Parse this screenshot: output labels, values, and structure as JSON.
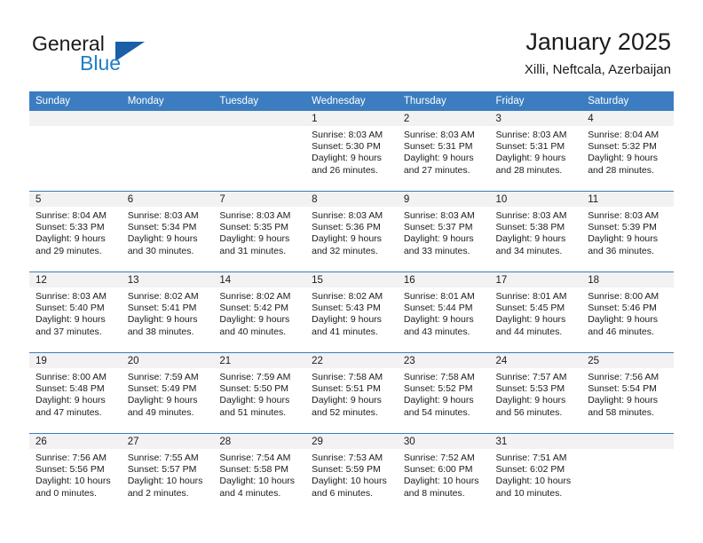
{
  "brand": {
    "word1": "General",
    "word2": "Blue",
    "logo_icon": "triangle-logo-icon",
    "colors": {
      "accent": "#1f7fc4",
      "triangle": "#1a5fa8",
      "text": "#1b1b1b"
    }
  },
  "header": {
    "title": "January 2025",
    "subtitle": "Xilli, Neftcala, Azerbaijan"
  },
  "calendar": {
    "header_background": "#3b7dc0",
    "daynum_band_background": "#f2f2f2",
    "weekday_headers": [
      "Sunday",
      "Monday",
      "Tuesday",
      "Wednesday",
      "Thursday",
      "Friday",
      "Saturday"
    ],
    "weeks": [
      [
        {
          "day": "",
          "lines": []
        },
        {
          "day": "",
          "lines": []
        },
        {
          "day": "",
          "lines": []
        },
        {
          "day": "1",
          "lines": [
            "Sunrise: 8:03 AM",
            "Sunset: 5:30 PM",
            "Daylight: 9 hours",
            "and 26 minutes."
          ]
        },
        {
          "day": "2",
          "lines": [
            "Sunrise: 8:03 AM",
            "Sunset: 5:31 PM",
            "Daylight: 9 hours",
            "and 27 minutes."
          ]
        },
        {
          "day": "3",
          "lines": [
            "Sunrise: 8:03 AM",
            "Sunset: 5:31 PM",
            "Daylight: 9 hours",
            "and 28 minutes."
          ]
        },
        {
          "day": "4",
          "lines": [
            "Sunrise: 8:04 AM",
            "Sunset: 5:32 PM",
            "Daylight: 9 hours",
            "and 28 minutes."
          ]
        }
      ],
      [
        {
          "day": "5",
          "lines": [
            "Sunrise: 8:04 AM",
            "Sunset: 5:33 PM",
            "Daylight: 9 hours",
            "and 29 minutes."
          ]
        },
        {
          "day": "6",
          "lines": [
            "Sunrise: 8:03 AM",
            "Sunset: 5:34 PM",
            "Daylight: 9 hours",
            "and 30 minutes."
          ]
        },
        {
          "day": "7",
          "lines": [
            "Sunrise: 8:03 AM",
            "Sunset: 5:35 PM",
            "Daylight: 9 hours",
            "and 31 minutes."
          ]
        },
        {
          "day": "8",
          "lines": [
            "Sunrise: 8:03 AM",
            "Sunset: 5:36 PM",
            "Daylight: 9 hours",
            "and 32 minutes."
          ]
        },
        {
          "day": "9",
          "lines": [
            "Sunrise: 8:03 AM",
            "Sunset: 5:37 PM",
            "Daylight: 9 hours",
            "and 33 minutes."
          ]
        },
        {
          "day": "10",
          "lines": [
            "Sunrise: 8:03 AM",
            "Sunset: 5:38 PM",
            "Daylight: 9 hours",
            "and 34 minutes."
          ]
        },
        {
          "day": "11",
          "lines": [
            "Sunrise: 8:03 AM",
            "Sunset: 5:39 PM",
            "Daylight: 9 hours",
            "and 36 minutes."
          ]
        }
      ],
      [
        {
          "day": "12",
          "lines": [
            "Sunrise: 8:03 AM",
            "Sunset: 5:40 PM",
            "Daylight: 9 hours",
            "and 37 minutes."
          ]
        },
        {
          "day": "13",
          "lines": [
            "Sunrise: 8:02 AM",
            "Sunset: 5:41 PM",
            "Daylight: 9 hours",
            "and 38 minutes."
          ]
        },
        {
          "day": "14",
          "lines": [
            "Sunrise: 8:02 AM",
            "Sunset: 5:42 PM",
            "Daylight: 9 hours",
            "and 40 minutes."
          ]
        },
        {
          "day": "15",
          "lines": [
            "Sunrise: 8:02 AM",
            "Sunset: 5:43 PM",
            "Daylight: 9 hours",
            "and 41 minutes."
          ]
        },
        {
          "day": "16",
          "lines": [
            "Sunrise: 8:01 AM",
            "Sunset: 5:44 PM",
            "Daylight: 9 hours",
            "and 43 minutes."
          ]
        },
        {
          "day": "17",
          "lines": [
            "Sunrise: 8:01 AM",
            "Sunset: 5:45 PM",
            "Daylight: 9 hours",
            "and 44 minutes."
          ]
        },
        {
          "day": "18",
          "lines": [
            "Sunrise: 8:00 AM",
            "Sunset: 5:46 PM",
            "Daylight: 9 hours",
            "and 46 minutes."
          ]
        }
      ],
      [
        {
          "day": "19",
          "lines": [
            "Sunrise: 8:00 AM",
            "Sunset: 5:48 PM",
            "Daylight: 9 hours",
            "and 47 minutes."
          ]
        },
        {
          "day": "20",
          "lines": [
            "Sunrise: 7:59 AM",
            "Sunset: 5:49 PM",
            "Daylight: 9 hours",
            "and 49 minutes."
          ]
        },
        {
          "day": "21",
          "lines": [
            "Sunrise: 7:59 AM",
            "Sunset: 5:50 PM",
            "Daylight: 9 hours",
            "and 51 minutes."
          ]
        },
        {
          "day": "22",
          "lines": [
            "Sunrise: 7:58 AM",
            "Sunset: 5:51 PM",
            "Daylight: 9 hours",
            "and 52 minutes."
          ]
        },
        {
          "day": "23",
          "lines": [
            "Sunrise: 7:58 AM",
            "Sunset: 5:52 PM",
            "Daylight: 9 hours",
            "and 54 minutes."
          ]
        },
        {
          "day": "24",
          "lines": [
            "Sunrise: 7:57 AM",
            "Sunset: 5:53 PM",
            "Daylight: 9 hours",
            "and 56 minutes."
          ]
        },
        {
          "day": "25",
          "lines": [
            "Sunrise: 7:56 AM",
            "Sunset: 5:54 PM",
            "Daylight: 9 hours",
            "and 58 minutes."
          ]
        }
      ],
      [
        {
          "day": "26",
          "lines": [
            "Sunrise: 7:56 AM",
            "Sunset: 5:56 PM",
            "Daylight: 10 hours",
            "and 0 minutes."
          ]
        },
        {
          "day": "27",
          "lines": [
            "Sunrise: 7:55 AM",
            "Sunset: 5:57 PM",
            "Daylight: 10 hours",
            "and 2 minutes."
          ]
        },
        {
          "day": "28",
          "lines": [
            "Sunrise: 7:54 AM",
            "Sunset: 5:58 PM",
            "Daylight: 10 hours",
            "and 4 minutes."
          ]
        },
        {
          "day": "29",
          "lines": [
            "Sunrise: 7:53 AM",
            "Sunset: 5:59 PM",
            "Daylight: 10 hours",
            "and 6 minutes."
          ]
        },
        {
          "day": "30",
          "lines": [
            "Sunrise: 7:52 AM",
            "Sunset: 6:00 PM",
            "Daylight: 10 hours",
            "and 8 minutes."
          ]
        },
        {
          "day": "31",
          "lines": [
            "Sunrise: 7:51 AM",
            "Sunset: 6:02 PM",
            "Daylight: 10 hours",
            "and 10 minutes."
          ]
        },
        {
          "day": "",
          "lines": []
        }
      ]
    ]
  }
}
